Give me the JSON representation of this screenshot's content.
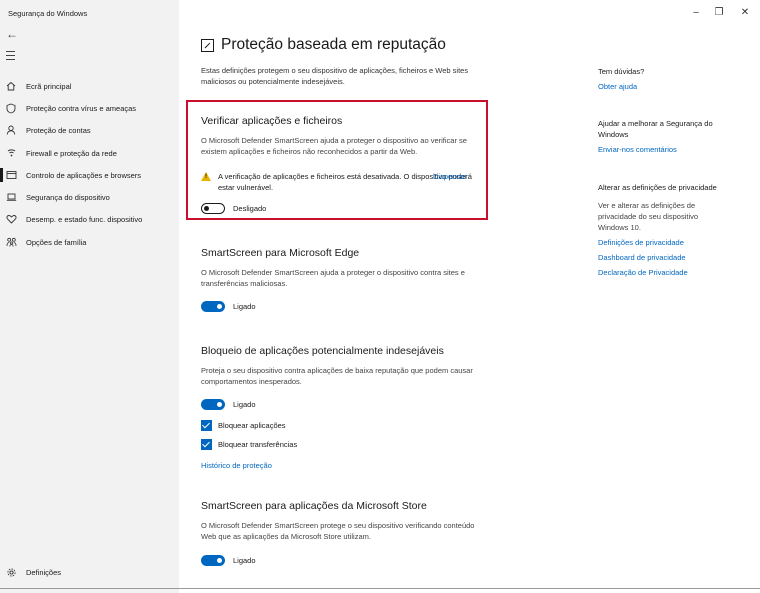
{
  "app": {
    "title": "Segurança do Windows",
    "controls": {
      "minimize": "–",
      "maximize": "❐",
      "close": "✕"
    }
  },
  "sidebar": {
    "back_icon": "back-arrow-icon",
    "menu_icon": "hamburger-menu-icon",
    "items": [
      {
        "label": "Ecrã principal",
        "icon": "home-icon"
      },
      {
        "label": "Proteção contra vírus e ameaças",
        "icon": "shield-icon"
      },
      {
        "label": "Proteção de contas",
        "icon": "person-icon"
      },
      {
        "label": "Firewall e proteção da rede",
        "icon": "wifi-icon"
      },
      {
        "label": "Controlo de aplicações e browsers",
        "icon": "browser-window-icon",
        "active": true
      },
      {
        "label": "Segurança do dispositivo",
        "icon": "laptop-icon"
      },
      {
        "label": "Desemp. e estado func. dispositivo",
        "icon": "heart-icon"
      },
      {
        "label": "Opções de família",
        "icon": "family-icon"
      }
    ],
    "settings_label": "Definições",
    "settings_icon": "gear-icon"
  },
  "main": {
    "title": "Proteção baseada em reputação",
    "intro": "Estas definições protegem o seu dispositivo de aplicações, ficheiros e Web sites maliciosos ou potencialmente indesejáveis.",
    "sections": {
      "apps_files": {
        "title": "Verificar aplicações e ficheiros",
        "desc": "O Microsoft Defender SmartScreen ajuda a proteger o dispositivo ao verificar se existem aplicações e ficheiros não reconhecidos a partir da Web.",
        "warning": "A verificação de aplicações e ficheiros está desativada. O dispositivo poderá estar vulnerável.",
        "dismiss": "Dispensar",
        "toggle_label": "Desligado",
        "toggle_on": false
      },
      "edge": {
        "title": "SmartScreen para Microsoft Edge",
        "desc": "O Microsoft Defender SmartScreen ajuda a proteger o dispositivo contra sites e transferências maliciosas.",
        "toggle_label": "Ligado",
        "toggle_on": true
      },
      "pua": {
        "title": "Bloqueio de aplicações potencialmente indesejáveis",
        "desc": "Proteja o seu dispositivo contra aplicações de baixa reputação que podem causar comportamentos inesperados.",
        "toggle_label": "Ligado",
        "toggle_on": true,
        "check_apps": "Bloquear aplicações",
        "check_downloads": "Bloquear transferências",
        "history_link": "Histórico de proteção"
      },
      "store": {
        "title": "SmartScreen para aplicações da Microsoft Store",
        "desc": "O Microsoft Defender SmartScreen protege o seu dispositivo verificando conteúdo Web que as aplicações da Microsoft Store utilizam.",
        "toggle_label": "Ligado",
        "toggle_on": true
      }
    }
  },
  "right": {
    "questions_title": "Tem dúvidas?",
    "get_help": "Obter ajuda",
    "improve_title": "Ajudar a melhorar a Segurança do Windows",
    "feedback": "Enviar-nos comentários",
    "privacy_title": "Alterar as definições de privacidade",
    "privacy_desc": "Ver e alterar as definições de privacidade do seu dispositivo Windows 10.",
    "privacy_settings": "Definições de privacidade",
    "privacy_dashboard": "Dashboard de privacidade",
    "privacy_statement": "Declaração de Privacidade"
  },
  "colors": {
    "accent": "#0067c0",
    "highlight_border": "#c8102e",
    "warning": "#e8b400",
    "sidebar_bg": "#f2f2f2"
  }
}
